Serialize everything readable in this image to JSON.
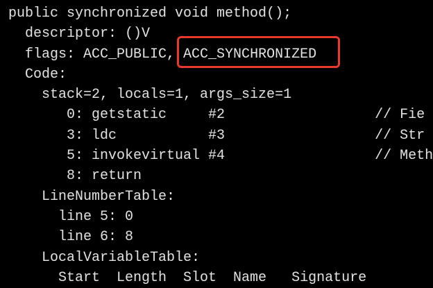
{
  "terminal": {
    "lines": [
      "public synchronized void method();",
      "  descriptor: ()V",
      "  flags: ACC_PUBLIC, ",
      "  Code:",
      "    stack=2, locals=1, args_size=1",
      "       0: getstatic     #2                  // Fie",
      "       3: ldc           #3                  // Str",
      "       5: invokevirtual #4                  // Meth",
      "       8: return",
      "    LineNumberTable:",
      "      line 5: 0",
      "      line 6: 8",
      "    LocalVariableTable:",
      "      Start  Length  Slot  Name   Signature"
    ],
    "highlighted_flag": "ACC_SYNCHRONIZED",
    "highlight_color": "#e8392c"
  }
}
